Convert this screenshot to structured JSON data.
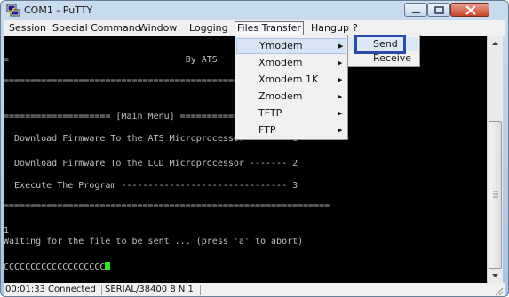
{
  "window": {
    "title": "COM1 - PuTTY"
  },
  "menubar": [
    "Session",
    "Special Command",
    "Window",
    "Logging",
    "Files Transfer",
    "Hangup",
    "?"
  ],
  "terminal": {
    "lines": [
      "=                                 By ATS",
      "===============================================",
      "==================== [Main Menu] ============",
      "  Download Firmware To the ATS Microprocessor ------- 1",
      "  Download Firmware To the LCD Microprocessor ------- 2",
      "  Execute The Program ------------------------------- 3",
      "=============================================================",
      "1",
      "Waiting for the file to be sent ... (press 'a' to abort)",
      "CCCCCCCCCCCCCCCCCCC"
    ]
  },
  "statusbar": {
    "elapsed": "00:01:33",
    "state": "Connected",
    "port": "SERIAL/38400 8 N 1"
  },
  "files_transfer_menu": {
    "items": [
      {
        "label": "Ymodem",
        "has_submenu": true,
        "highlighted": true
      },
      {
        "label": "Xmodem",
        "has_submenu": true
      },
      {
        "label": "Xmodem 1K",
        "has_submenu": true
      },
      {
        "label": "Zmodem",
        "has_submenu": true
      },
      {
        "label": "TFTP",
        "has_submenu": true
      },
      {
        "label": "FTP",
        "has_submenu": true
      }
    ],
    "submenu_items": [
      {
        "label": "Send",
        "highlighted": true
      },
      {
        "label": "Receive"
      }
    ],
    "submenu_arrow": "▶"
  },
  "colors": {
    "terminal_bg": "#000000",
    "terminal_fg": "#c0c0c0",
    "cursor": "#2ee32e",
    "callout": "#2b4ba8"
  }
}
